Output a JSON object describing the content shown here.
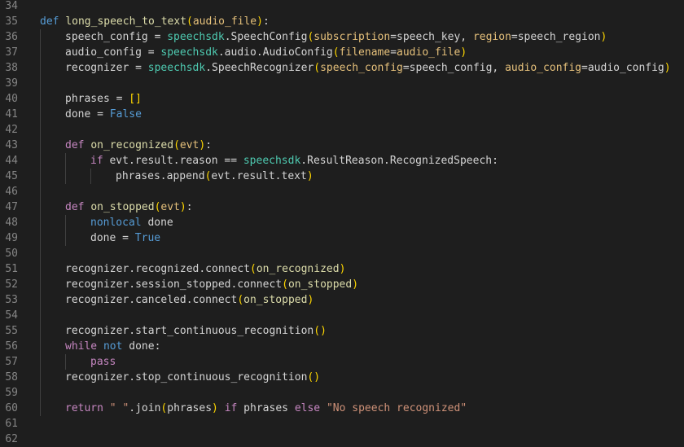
{
  "colors": {
    "background": "#1e1e1e",
    "line_number": "#858585",
    "default": "#d4d4d4",
    "keyword": "#569cd6",
    "control": "#c586c0",
    "function": "#dcdcaa",
    "param": "#9cdcfe",
    "module": "#4ec9b0",
    "string": "#ce9178",
    "kwarg": "#e5c07b",
    "bracket1": "#ffd700",
    "bracket2": "#da70d6"
  },
  "editor": {
    "lines": [
      {
        "n": "34",
        "indent": 0,
        "tokens": []
      },
      {
        "n": "35",
        "indent": 0,
        "tokens": [
          {
            "t": "def",
            "c": "keyword"
          },
          {
            "t": " "
          },
          {
            "t": "long_speech_to_text",
            "c": "function"
          },
          {
            "t": "(",
            "c": "bracket1"
          },
          {
            "t": "audio_file",
            "c": "kwarg"
          },
          {
            "t": ")",
            "c": "bracket1"
          },
          {
            "t": ":"
          }
        ]
      },
      {
        "n": "36",
        "indent": 1,
        "tokens": [
          {
            "t": "speech_config"
          },
          {
            "t": " = "
          },
          {
            "t": "speechsdk",
            "c": "module"
          },
          {
            "t": ".SpeechConfig"
          },
          {
            "t": "(",
            "c": "bracket1"
          },
          {
            "t": "subscription",
            "c": "kwarg"
          },
          {
            "t": "=speech_key, "
          },
          {
            "t": "region",
            "c": "kwarg"
          },
          {
            "t": "=speech_region"
          },
          {
            "t": ")",
            "c": "bracket1"
          }
        ]
      },
      {
        "n": "37",
        "indent": 1,
        "tokens": [
          {
            "t": "audio_config"
          },
          {
            "t": " = "
          },
          {
            "t": "speechsdk",
            "c": "module"
          },
          {
            "t": ".audio.AudioConfig"
          },
          {
            "t": "(",
            "c": "bracket1"
          },
          {
            "t": "filename",
            "c": "kwarg"
          },
          {
            "t": "="
          },
          {
            "t": "audio_file",
            "c": "kwarg"
          },
          {
            "t": ")",
            "c": "bracket1"
          }
        ]
      },
      {
        "n": "38",
        "indent": 1,
        "tokens": [
          {
            "t": "recognizer"
          },
          {
            "t": " = "
          },
          {
            "t": "speechsdk",
            "c": "module"
          },
          {
            "t": ".SpeechRecognizer"
          },
          {
            "t": "(",
            "c": "bracket1"
          },
          {
            "t": "speech_config",
            "c": "kwarg"
          },
          {
            "t": "=speech_config, "
          },
          {
            "t": "audio_config",
            "c": "kwarg"
          },
          {
            "t": "=audio_config"
          },
          {
            "t": ")",
            "c": "bracket1"
          }
        ]
      },
      {
        "n": "39",
        "indent": 1,
        "tokens": []
      },
      {
        "n": "40",
        "indent": 1,
        "tokens": [
          {
            "t": "phrases"
          },
          {
            "t": " = "
          },
          {
            "t": "[]",
            "c": "bracket1"
          }
        ]
      },
      {
        "n": "41",
        "indent": 1,
        "tokens": [
          {
            "t": "done"
          },
          {
            "t": " = "
          },
          {
            "t": "False",
            "c": "keyword"
          }
        ]
      },
      {
        "n": "42",
        "indent": 1,
        "tokens": []
      },
      {
        "n": "43",
        "indent": 1,
        "tokens": [
          {
            "t": "def",
            "c": "control"
          },
          {
            "t": " "
          },
          {
            "t": "on_recognized",
            "c": "function"
          },
          {
            "t": "(",
            "c": "bracket1"
          },
          {
            "t": "evt",
            "c": "kwarg"
          },
          {
            "t": ")",
            "c": "bracket1"
          },
          {
            "t": ":"
          }
        ]
      },
      {
        "n": "44",
        "indent": 2,
        "tokens": [
          {
            "t": "if",
            "c": "control"
          },
          {
            "t": " evt.result.reason == "
          },
          {
            "t": "speechsdk",
            "c": "module"
          },
          {
            "t": ".ResultReason.RecognizedSpeech:"
          }
        ]
      },
      {
        "n": "45",
        "indent": 3,
        "tokens": [
          {
            "t": "phrases.append"
          },
          {
            "t": "(",
            "c": "bracket1"
          },
          {
            "t": "evt.result.text"
          },
          {
            "t": ")",
            "c": "bracket1"
          }
        ]
      },
      {
        "n": "46",
        "indent": 1,
        "tokens": []
      },
      {
        "n": "47",
        "indent": 1,
        "tokens": [
          {
            "t": "def",
            "c": "control"
          },
          {
            "t": " "
          },
          {
            "t": "on_stopped",
            "c": "function"
          },
          {
            "t": "(",
            "c": "bracket1"
          },
          {
            "t": "evt",
            "c": "kwarg"
          },
          {
            "t": ")",
            "c": "bracket1"
          },
          {
            "t": ":"
          }
        ]
      },
      {
        "n": "48",
        "indent": 2,
        "tokens": [
          {
            "t": "nonlocal",
            "c": "keyword"
          },
          {
            "t": " done"
          }
        ]
      },
      {
        "n": "49",
        "indent": 2,
        "tokens": [
          {
            "t": "done"
          },
          {
            "t": " = "
          },
          {
            "t": "True",
            "c": "keyword"
          }
        ]
      },
      {
        "n": "50",
        "indent": 1,
        "tokens": []
      },
      {
        "n": "51",
        "indent": 1,
        "tokens": [
          {
            "t": "recognizer.recognized.connect"
          },
          {
            "t": "(",
            "c": "bracket1"
          },
          {
            "t": "on_recognized",
            "c": "function"
          },
          {
            "t": ")",
            "c": "bracket1"
          }
        ]
      },
      {
        "n": "52",
        "indent": 1,
        "tokens": [
          {
            "t": "recognizer.session_stopped.connect"
          },
          {
            "t": "(",
            "c": "bracket1"
          },
          {
            "t": "on_stopped",
            "c": "function"
          },
          {
            "t": ")",
            "c": "bracket1"
          }
        ]
      },
      {
        "n": "53",
        "indent": 1,
        "tokens": [
          {
            "t": "recognizer.canceled.connect"
          },
          {
            "t": "(",
            "c": "bracket1"
          },
          {
            "t": "on_stopped",
            "c": "function"
          },
          {
            "t": ")",
            "c": "bracket1"
          }
        ]
      },
      {
        "n": "54",
        "indent": 1,
        "tokens": []
      },
      {
        "n": "55",
        "indent": 1,
        "tokens": [
          {
            "t": "recognizer.start_continuous_recognition"
          },
          {
            "t": "()",
            "c": "bracket1"
          }
        ]
      },
      {
        "n": "56",
        "indent": 1,
        "tokens": [
          {
            "t": "while",
            "c": "control"
          },
          {
            "t": " "
          },
          {
            "t": "not",
            "c": "keyword"
          },
          {
            "t": " done:"
          }
        ]
      },
      {
        "n": "57",
        "indent": 2,
        "tokens": [
          {
            "t": "pass",
            "c": "control"
          }
        ]
      },
      {
        "n": "58",
        "indent": 1,
        "tokens": [
          {
            "t": "recognizer.stop_continuous_recognition"
          },
          {
            "t": "()",
            "c": "bracket1"
          }
        ]
      },
      {
        "n": "59",
        "indent": 1,
        "tokens": []
      },
      {
        "n": "60",
        "indent": 1,
        "tokens": [
          {
            "t": "return",
            "c": "control"
          },
          {
            "t": " "
          },
          {
            "t": "\" \"",
            "c": "string"
          },
          {
            "t": ".join"
          },
          {
            "t": "(",
            "c": "bracket1"
          },
          {
            "t": "phrases"
          },
          {
            "t": ")",
            "c": "bracket1"
          },
          {
            "t": " "
          },
          {
            "t": "if",
            "c": "control"
          },
          {
            "t": " phrases "
          },
          {
            "t": "else",
            "c": "control"
          },
          {
            "t": " "
          },
          {
            "t": "\"No speech recognized\"",
            "c": "string"
          }
        ]
      },
      {
        "n": "61",
        "indent": 0,
        "tokens": []
      },
      {
        "n": "62",
        "indent": 0,
        "tokens": []
      }
    ]
  }
}
